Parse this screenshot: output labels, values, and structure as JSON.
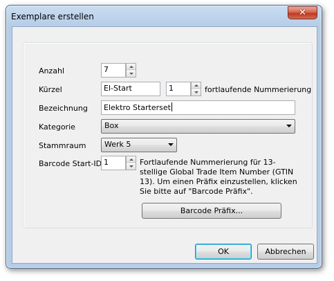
{
  "window": {
    "title": "Exemplare erstellen",
    "close_glyph": "✕"
  },
  "form": {
    "anzahl": {
      "label": "Anzahl",
      "value": "7"
    },
    "kuerzel": {
      "label": "Kürzel",
      "value": "El-Start",
      "counter_value": "1",
      "counter_suffix": "fortlaufende Nummerierung"
    },
    "bezeichnung": {
      "label": "Bezeichnung",
      "value": "Elektro Starterset"
    },
    "kategorie": {
      "label": "Kategorie",
      "selected": "Box"
    },
    "stammraum": {
      "label": "Stammraum",
      "selected": "Werk 5"
    },
    "barcode": {
      "label": "Barcode Start-ID",
      "value": "1",
      "description": "Fortlaufende Nummerierung für 13-stellige Global Trade Item Number (GTIN 13). Um einen Präfix einzustellen, klicken Sie bitte auf \"Barcode Präfix\".",
      "prefix_button": "Barcode Präfix..."
    }
  },
  "buttons": {
    "ok": "OK",
    "cancel": "Abbrechen"
  }
}
